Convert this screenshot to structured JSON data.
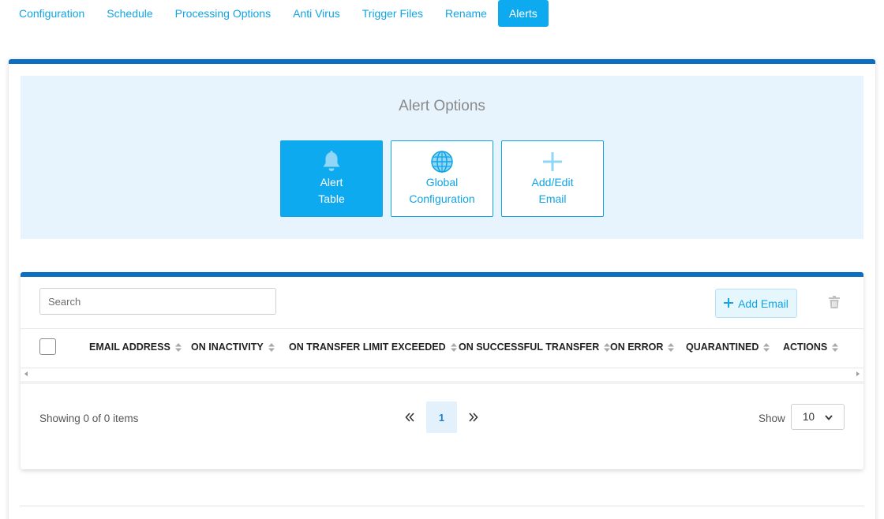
{
  "tabs": [
    {
      "label": "Configuration",
      "active": false
    },
    {
      "label": "Schedule",
      "active": false
    },
    {
      "label": "Processing Options",
      "active": false
    },
    {
      "label": "Anti Virus",
      "active": false
    },
    {
      "label": "Trigger Files",
      "active": false
    },
    {
      "label": "Rename",
      "active": false
    },
    {
      "label": "Alerts",
      "active": true
    }
  ],
  "alert_options": {
    "title": "Alert Options",
    "buttons": [
      {
        "line1": "Alert",
        "line2": "Table",
        "icon": "bell-icon",
        "active": true
      },
      {
        "line1": "Global",
        "line2": "Configuration",
        "icon": "globe-icon",
        "active": false
      },
      {
        "line1": "Add/Edit",
        "line2": "Email",
        "icon": "plus-icon",
        "active": false
      }
    ]
  },
  "table": {
    "search_placeholder": "Search",
    "add_email_label": "Add Email",
    "columns": [
      "EMAIL ADDRESS",
      "ON INACTIVITY",
      "ON TRANSFER LIMIT EXCEEDED",
      "ON SUCCESSFUL TRANSFER",
      "ON ERROR",
      "QUARANTINED",
      "ACTIONS"
    ],
    "rows": []
  },
  "pagination": {
    "showing_text": "Showing 0 of 0 items",
    "current_page": "1",
    "show_label": "Show",
    "page_size": "10"
  },
  "colors": {
    "accent": "#0eaaf0",
    "header_bar": "#0a6fc2",
    "panel_bg": "#e8f4fd"
  }
}
